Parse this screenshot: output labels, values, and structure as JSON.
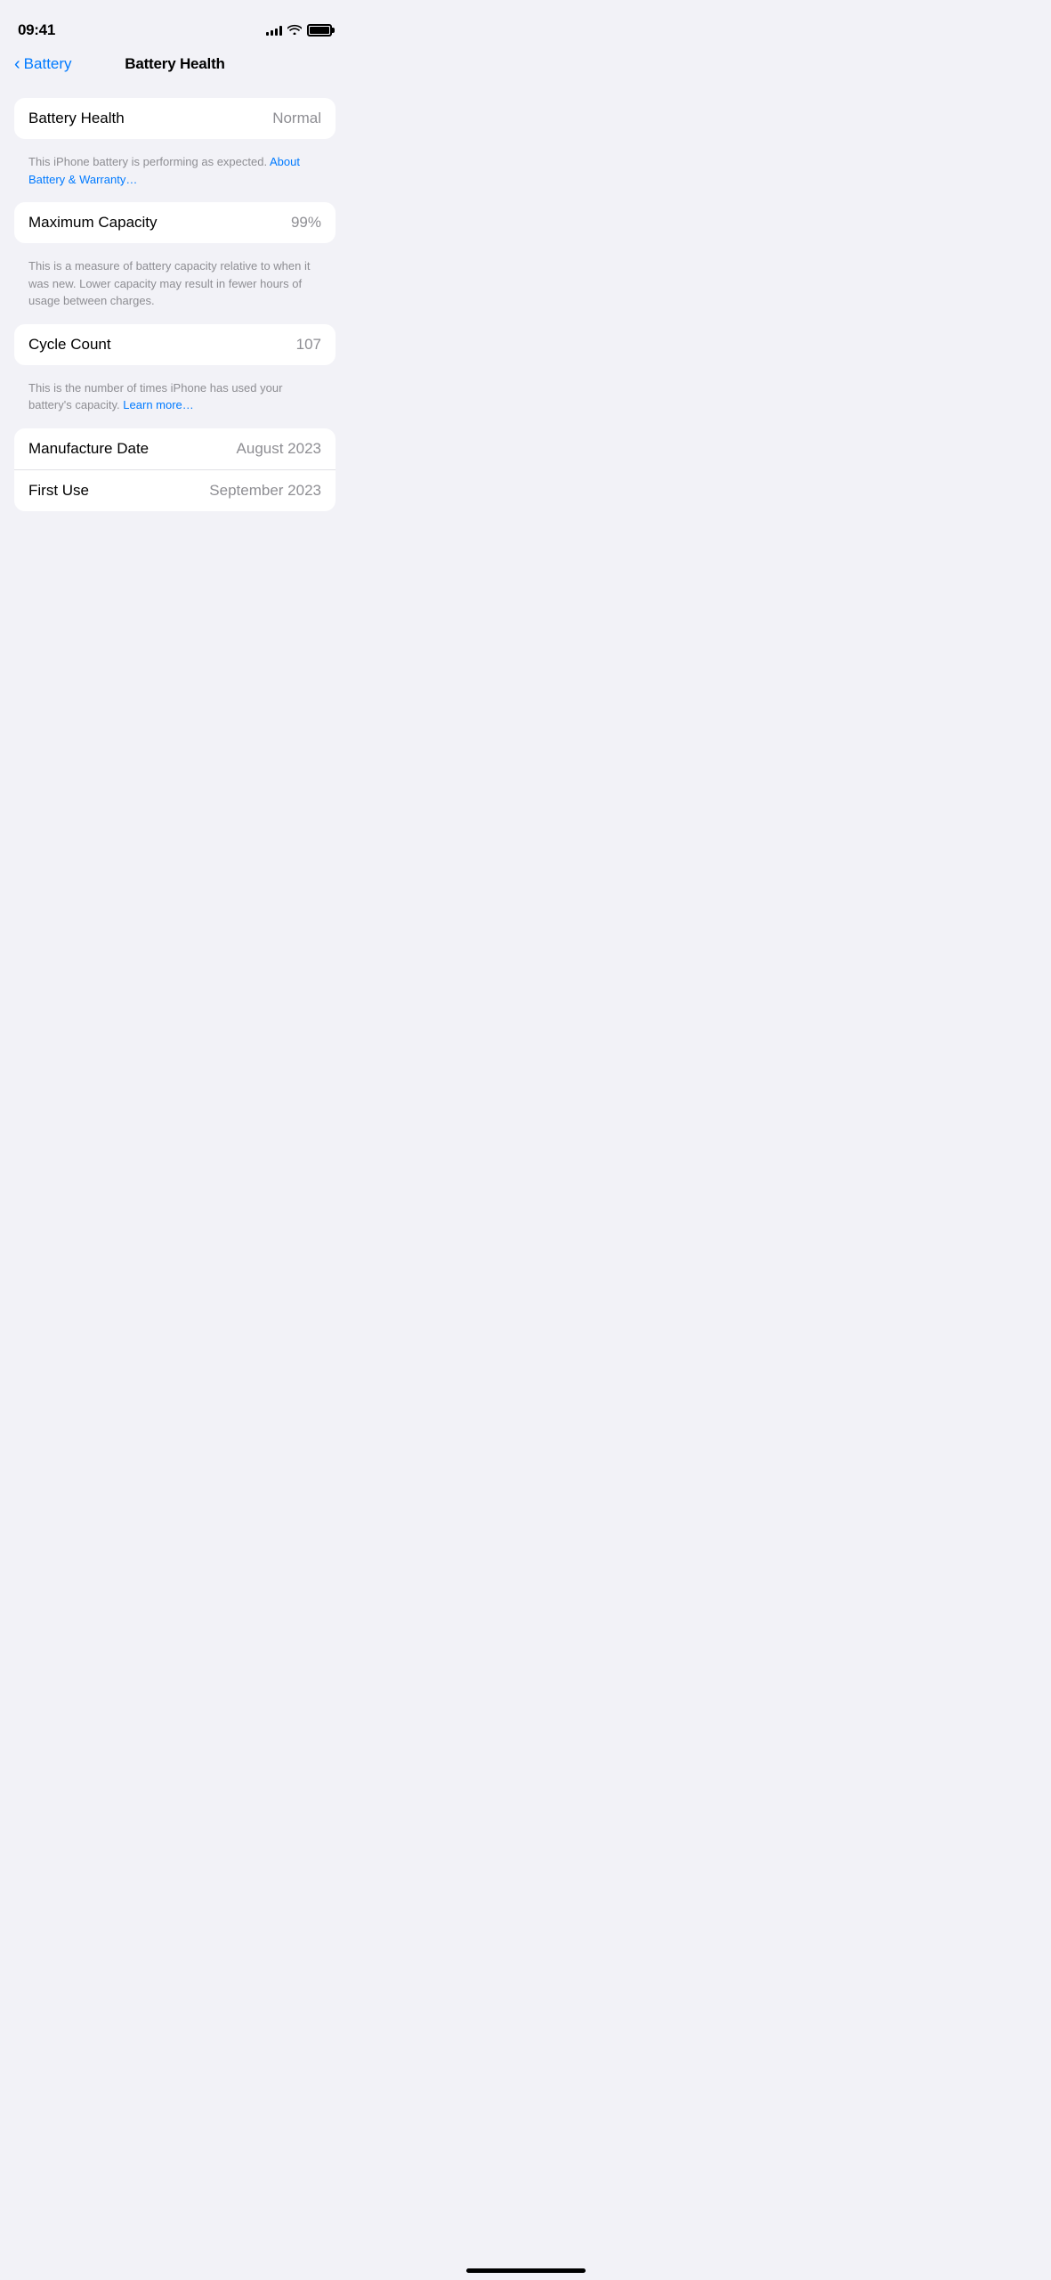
{
  "statusBar": {
    "time": "09:41",
    "battery": "full"
  },
  "navBar": {
    "backLabel": "Battery",
    "title": "Battery Health"
  },
  "sections": [
    {
      "id": "battery-health-section",
      "rows": [
        {
          "label": "Battery Health",
          "value": "Normal"
        }
      ],
      "description": "This iPhone battery is performing as expected.",
      "descriptionLink": "About Battery & Warranty…",
      "hasLink": true
    },
    {
      "id": "maximum-capacity-section",
      "rows": [
        {
          "label": "Maximum Capacity",
          "value": "99%"
        }
      ],
      "description": "This is a measure of battery capacity relative to when it was new. Lower capacity may result in fewer hours of usage between charges.",
      "hasLink": false
    },
    {
      "id": "cycle-count-section",
      "rows": [
        {
          "label": "Cycle Count",
          "value": "107"
        }
      ],
      "description": "This is the number of times iPhone has used your battery's capacity.",
      "descriptionLink": "Learn more…",
      "hasLink": true
    },
    {
      "id": "dates-section",
      "rows": [
        {
          "label": "Manufacture Date",
          "value": "August 2023"
        },
        {
          "label": "First Use",
          "value": "September 2023"
        }
      ],
      "hasLink": false
    }
  ]
}
